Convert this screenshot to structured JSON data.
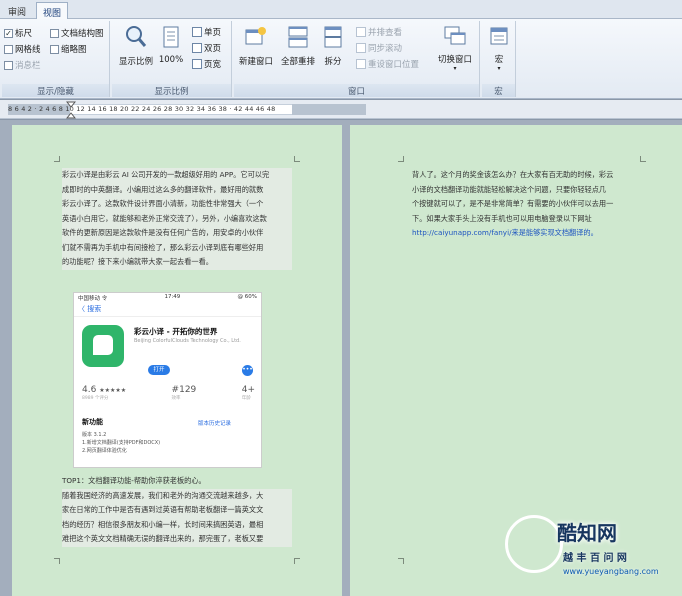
{
  "tabs": [
    {
      "label": "审阅",
      "active": false
    },
    {
      "label": "视图",
      "active": true
    }
  ],
  "ribbon": {
    "show_group": {
      "label": "显示/隐藏",
      "checks": [
        {
          "label": "标尺",
          "checked": true
        },
        {
          "label": "网格线",
          "checked": false
        },
        {
          "label": "消息栏",
          "checked": false,
          "disabled": true
        },
        {
          "label": "文档结构图",
          "checked": false
        },
        {
          "label": "缩略图",
          "checked": false
        }
      ]
    },
    "zoom_group": {
      "label": "显示比例",
      "zoom_button": "显示比例",
      "hundred_button": "100%",
      "single_page": "单页",
      "double_page": "双页",
      "page_width": "页宽"
    },
    "window_group": {
      "label": "窗口",
      "new_window": "新建窗口",
      "arrange_all": "全部重排",
      "split": "拆分",
      "side_by_side": "并排查看",
      "sync_scroll": "同步滚动",
      "reset_position": "重设窗口位置",
      "switch_window": "切换窗口"
    },
    "macro_group": {
      "label": "宏",
      "macro": "宏"
    }
  },
  "ruler": {
    "numbers": "8 6 4 2 · 2 4 6 8 10 12 14 16 18 20 22 24 26 28 30 32 34 36 38 · 42 44 46 48"
  },
  "page1": {
    "lines": [
      "彩云小译是由彩云 AI 公司开发的一款超级好用的 APP。它可以完",
      "成即时的中英翻译。小编用过这么多的翻译软件，最好用的就数",
      "彩云小译了。这款软件设计界面小清新，功能性非常强大（一个",
      "英语小白用它，就能够和老外正常交流了），另外，小编喜欢这款",
      "软件的更新原因是这款软件是没有任何广告的，用安卓的小伙伴",
      "们就不需再为手机中有间接检了，那么彩云小译到底有哪些好用",
      "的功能呢？接下来小编就带大家一起去看一看。"
    ],
    "tip_line": "TOP1：文档翻译功能-帮助你淬获老板的心。",
    "after_lines": [
      "随着我国经济的高速发展，我们和老外的沟通交流越来越多，大",
      "家在日常的工作中是否有遇到过英语有帮助老板翻译一篇英文文",
      "档的经历？相信很多朋友和小编一样，长时间来搞困英语，最相",
      "难把这个英文文档精确无误的翻译出来的，那完蛋了，老板又要"
    ]
  },
  "phone": {
    "carrier": "中国移动 令",
    "time": "17:49",
    "battery": "@ 60%",
    "back": "〈 搜索",
    "app_title": "彩云小译 - 开拓你的世界",
    "app_sub": "Beijing ColorfulClouds Technology Co., Ltd.",
    "open": "打开",
    "more": "•••",
    "rating": "4.6",
    "stars": "★★★★★",
    "rating_sub": "8989 个评分",
    "rank": "#129",
    "rank_sub": "效率",
    "age": "4+",
    "age_sub": "年龄",
    "new_features": "新功能",
    "history": "版本历史记录",
    "version": "版本 3.1.2",
    "feature1": "1.新增文档翻译(支持PDF和DOCX)",
    "feature2": "2.网页翻译体验优化"
  },
  "page2": {
    "lines": [
      "背人了。这个月的奖金该怎么办？在大家有百无助的时候，彩云",
      "小译的文档翻译功能就能轻松解决这个问题，只要你轻轻点几",
      "个按键就可以了，是不是非常简单？有需要的小伙伴可以去用一",
      "下。如果大家手头上没有手机也可以用电脑登录以下网址"
    ],
    "link": "http://caiyunapp.com/fanyi/",
    "link_tail": "来是能够实现文档翻译的。"
  },
  "watermark": {
    "logo": "酷知网",
    "sub": "越 丰 百 问 网",
    "url": "www.yueyangbang.com"
  }
}
